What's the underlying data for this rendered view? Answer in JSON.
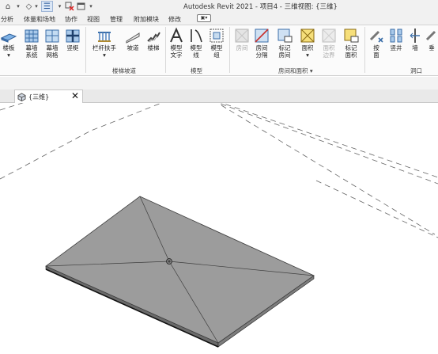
{
  "title_bar": {
    "app_title": "Autodesk Revit 2021 - 项目4 - 三维视图: {三维}",
    "qat_icons": [
      "home-icon",
      "sync-icon",
      "measure-icon",
      "close-hidden-icon",
      "window-icon",
      "qat-dropdown-icon"
    ],
    "view_switch_icon": "view-switch-icon"
  },
  "menu": {
    "tabs": [
      "分析",
      "体量和场地",
      "协作",
      "视图",
      "管理",
      "附加模块",
      "修改"
    ]
  },
  "ribbon": {
    "build_tools": [
      {
        "label1": "楼板",
        "label2": "▾",
        "icon": "floor-icon"
      },
      {
        "label1": "幕墙",
        "label2": "系统",
        "icon": "curtain-system-icon"
      },
      {
        "label1": "幕墙",
        "label2": "网格",
        "icon": "curtain-grid-icon"
      },
      {
        "label1": "竖梃",
        "label2": "",
        "icon": "mullion-icon"
      }
    ],
    "circulation": {
      "panel_label": "楼梯坡道",
      "tools": [
        {
          "label1": "栏杆扶手",
          "label2": "▾",
          "icon": "railing-icon"
        },
        {
          "label1": "坡道",
          "label2": "",
          "icon": "ramp-icon"
        },
        {
          "label1": "楼梯",
          "label2": "",
          "icon": "stair-icon"
        }
      ]
    },
    "model": {
      "panel_label": "模型",
      "tools": [
        {
          "label1": "模型",
          "label2": "文字",
          "icon": "model-text-icon"
        },
        {
          "label1": "模型",
          "label2": "线",
          "icon": "model-line-icon"
        },
        {
          "label1": "模型",
          "label2": "组",
          "icon": "model-group-icon"
        }
      ]
    },
    "room_area": {
      "panel_label": "房间和面积 ▾",
      "tools": [
        {
          "label1": "房间",
          "label2": "",
          "icon": "room-icon",
          "disabled": true
        },
        {
          "label1": "房间",
          "label2": "分隔",
          "icon": "room-separator-icon",
          "disabled": false
        },
        {
          "label1": "标记",
          "label2": "房间",
          "icon": "tag-room-icon",
          "disabled": false
        },
        {
          "label1": "面积",
          "label2": "▾",
          "icon": "area-icon",
          "disabled": false
        },
        {
          "label1": "面积",
          "label2": "边界",
          "icon": "area-boundary-icon",
          "disabled": true
        },
        {
          "label1": "标记",
          "label2": "面积",
          "icon": "tag-area-icon",
          "disabled": false
        }
      ]
    },
    "opening": {
      "panel_label": "洞口",
      "tools": [
        {
          "label1": "按",
          "label2": "面",
          "icon": "by-face-icon"
        },
        {
          "label1": "竖井",
          "label2": "",
          "icon": "shaft-icon"
        },
        {
          "label1": "墙",
          "label2": "",
          "icon": "wall-opening-icon"
        },
        {
          "label1": "垂",
          "label2": "",
          "icon": "vertical-opening-icon"
        }
      ]
    }
  },
  "view_tab": {
    "label": "{三维}",
    "close": "✕",
    "icon": "view-3d-icon"
  },
  "colors": {
    "roof_top": "#9c9c9c",
    "roof_edge": "#3e3e3e",
    "roof_side": "#6a6a6a"
  }
}
